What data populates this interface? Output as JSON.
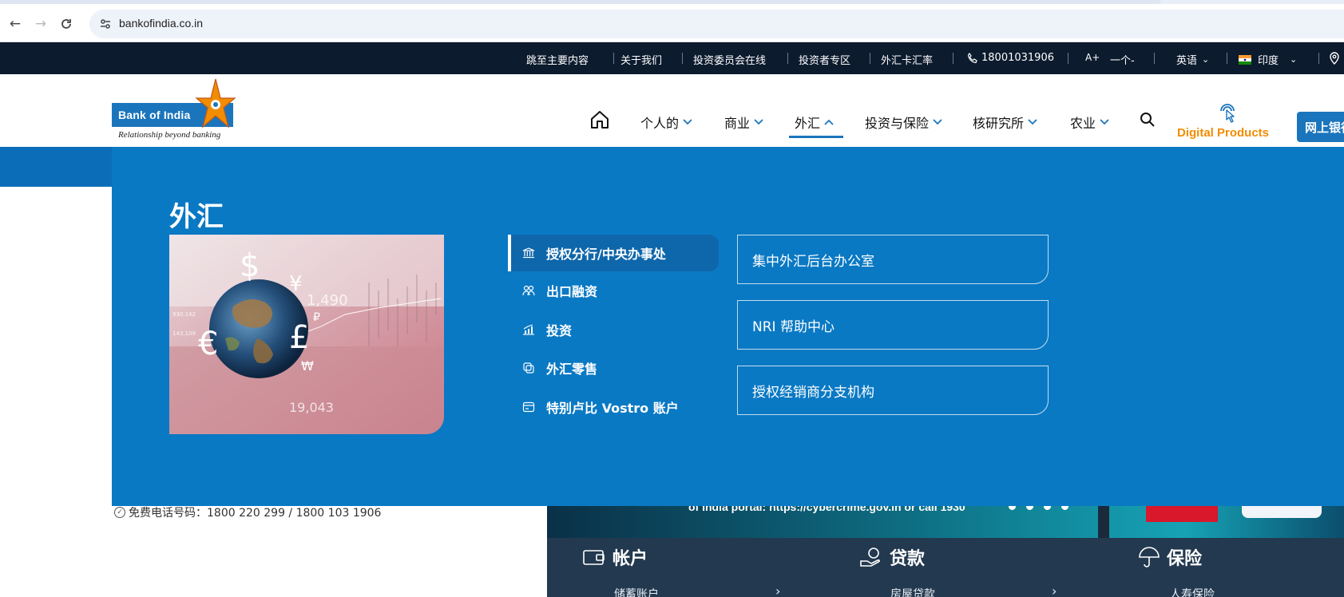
{
  "browser": {
    "url": "bankofindia.co.in"
  },
  "utility_bar": {
    "skip_link": "跳至主要内容",
    "about": "关于我们",
    "investor_committee": "投资委员会在线",
    "investor_zone": "投资者专区",
    "forex_rates": "外汇卡汇率",
    "phone": "18001031906",
    "font_increase": "A+",
    "font_normal": "一个-",
    "language": "英语",
    "country": "印度"
  },
  "header": {
    "logo_text": "Bank of India",
    "logo_tagline": "Relationship beyond banking",
    "nav": [
      "个人的",
      "商业",
      "外汇",
      "投资与保险",
      "核研究所",
      "农业"
    ],
    "active_nav": "外汇",
    "digital_products": "Digital Products",
    "netbanking": "网上银行"
  },
  "mega_menu": {
    "title": "外汇",
    "image_figures": [
      "$",
      "¥",
      "€",
      "£",
      "₩",
      "₽",
      "1,490",
      "19,043",
      "930.142",
      "143,109"
    ],
    "categories": [
      {
        "label": "授权分行/中央办事处",
        "icon": "bank-icon"
      },
      {
        "label": "出口融资",
        "icon": "export-finance-icon"
      },
      {
        "label": "投资",
        "icon": "investment-chart-icon"
      },
      {
        "label": "外汇零售",
        "icon": "forex-retail-icon"
      },
      {
        "label": "特别卢比 Vostro 账户",
        "icon": "vostro-account-icon"
      }
    ],
    "active_category": 0,
    "subitems": [
      "集中外汇后台办公室",
      "NRI 帮助中心",
      "授权经销商分支机构"
    ]
  },
  "page": {
    "toll_free": "免费电话号码：1800 220 299 / 1800 103 1906",
    "hero_caption": "of India portal: https://cybercrime.gov.in or call 1930",
    "quick_links": [
      {
        "heading": "帐户",
        "sub": "储蓄账户"
      },
      {
        "heading": "贷款",
        "sub": "房屋贷款"
      },
      {
        "heading": "保险",
        "sub": "人寿保险"
      }
    ]
  },
  "colors": {
    "brand_blue": "#1b75bc",
    "menu_blue": "#0a79c4",
    "utility_bar": "#0c1b2e",
    "digital_orange": "#f28c00"
  }
}
